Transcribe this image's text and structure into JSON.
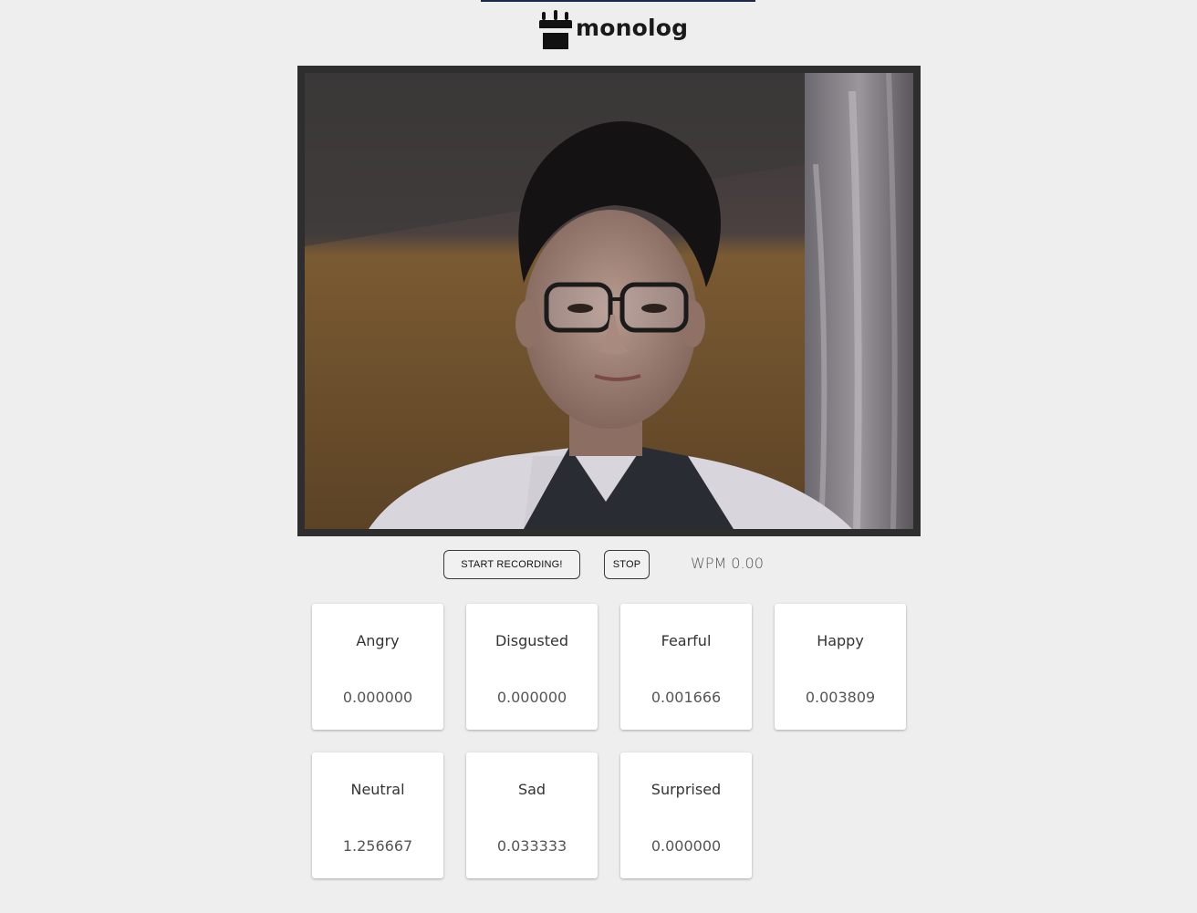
{
  "app": {
    "name": "monolog"
  },
  "controls": {
    "start_label": "START RECORDING!",
    "stop_label": "STOP",
    "wpm_label": "WPM",
    "wpm_value": "0.00"
  },
  "video": {
    "description": "webcam-feed"
  },
  "emotions": [
    {
      "label": "Angry",
      "value": "0.000000"
    },
    {
      "label": "Disgusted",
      "value": "0.000000"
    },
    {
      "label": "Fearful",
      "value": "0.001666"
    },
    {
      "label": "Happy",
      "value": "0.003809"
    },
    {
      "label": "Neutral",
      "value": "1.256667"
    },
    {
      "label": "Sad",
      "value": "0.033333"
    },
    {
      "label": "Surprised",
      "value": "0.000000"
    }
  ],
  "colors": {
    "background": "#eeeeee",
    "video_frame": "#2e2e2e",
    "card": "#ffffff",
    "topbar": "#1b2a4a"
  }
}
